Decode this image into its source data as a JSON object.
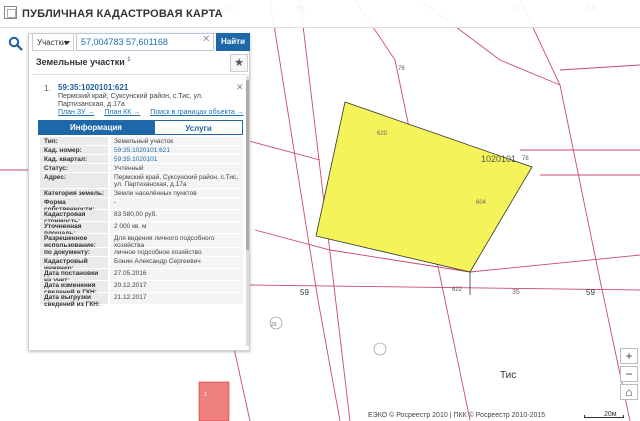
{
  "app": {
    "title": "ПУБЛИЧНАЯ КАДАСТРОВАЯ КАРТА"
  },
  "search": {
    "layer": "Участки",
    "value": "57,004783 57,601168",
    "clear": "✕",
    "button": "Найти"
  },
  "panel": {
    "title": "Земельные участки",
    "count": "1",
    "item": {
      "index": "1.",
      "cad_number": "59:35:1020101:621",
      "address": "Пермский край, Суксунский район, с.Тис, ул. Партизанская, д.17а",
      "links": [
        "План ЗУ →",
        "План КК →",
        "Поиск в границах объекта →"
      ],
      "close": "✕"
    },
    "tabs": {
      "info": "Информация",
      "services": "Услуги"
    },
    "attributes": [
      {
        "k": "Тип:",
        "v": "Земельный участок"
      },
      {
        "k": "Кад. номер:",
        "v": "59:35:1020101:621",
        "link": true
      },
      {
        "k": "Кад. квартал:",
        "v": "59:35:1020101",
        "link": true
      },
      {
        "k": "Статус:",
        "v": "Учтенный"
      },
      {
        "k": "Адрес:",
        "v": "Пермский край, Суксунский район, с.Тис, ул. Партизанская, д.17а"
      },
      {
        "k": "Категория земель:",
        "v": "Земли населённых пунктов"
      },
      {
        "k": "Форма собственности:",
        "v": "-"
      },
      {
        "k": "Кадастровая стоимость:",
        "v": "83 580,00 руб."
      },
      {
        "k": "Уточненная площадь:",
        "v": "2 000 кв. м"
      },
      {
        "k": "Разрешенное использование:",
        "v": "Для ведения личного подсобного хозяйства"
      },
      {
        "k": "по документу:",
        "v": "личное подсобное хозяйство"
      },
      {
        "k": "Кадастровый инженер:",
        "v": "Бонин Александр Сергеевич"
      },
      {
        "k": "Дата постановки на учет:",
        "v": "27.05.2016"
      },
      {
        "k": "Дата изменения сведений в ГКН:",
        "v": "20.12.2017"
      },
      {
        "k": "Дата выгрузки сведений из ГКН:",
        "v": "21.12.2017"
      }
    ]
  },
  "map": {
    "labels": {
      "q59a": "59",
      "q59b": "59",
      "q59c": "59",
      "q59d": "59",
      "q59e": "59",
      "q35a": "35",
      "q35b": "35",
      "q35c": "35",
      "block": "1020101",
      "p76": "76",
      "p78": "78",
      "p620": "620",
      "p604": "604",
      "p622": "622",
      "p23": "23",
      "settlement": "Тис",
      "p1": "1"
    },
    "parcel_color": "#f4f35a"
  },
  "footer": {
    "copyright": "ЕЭКО © Росреестр 2010 | ПКК © Росреестр 2010-2015",
    "scale": "20м"
  },
  "zoom": {
    "in": "+",
    "out": "−",
    "home": "⌂"
  }
}
